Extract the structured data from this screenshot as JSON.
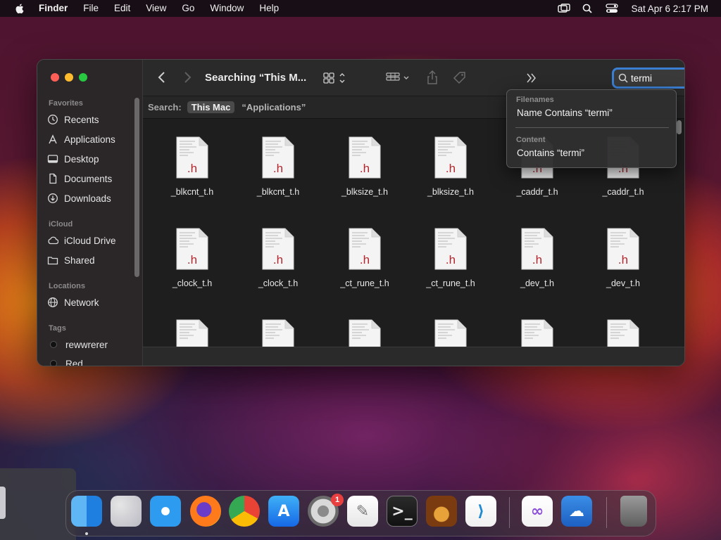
{
  "menubar": {
    "app_name": "Finder",
    "menus": [
      "File",
      "Edit",
      "View",
      "Go",
      "Window",
      "Help"
    ],
    "clock": "Sat Apr 6  2:17 PM"
  },
  "window": {
    "title": "Searching “This M...",
    "search_query": "termi"
  },
  "sidebar": {
    "favorites_header": "Favorites",
    "favorites": [
      "Recents",
      "Applications",
      "Desktop",
      "Documents",
      "Downloads"
    ],
    "icloud_header": "iCloud",
    "icloud": [
      "iCloud Drive",
      "Shared"
    ],
    "locations_header": "Locations",
    "locations": [
      "Network"
    ],
    "tags_header": "Tags",
    "tags": [
      "rewwrerer",
      "Red"
    ]
  },
  "scopebar": {
    "label": "Search:",
    "this_mac": "This Mac",
    "applications": "“Applications”"
  },
  "search_menu": {
    "filenames_header": "Filenames",
    "filenames_item": "Name Contains “termi”",
    "content_header": "Content",
    "content_item": "Contains “termi”"
  },
  "files": {
    "extension_badge": ".h",
    "row1": [
      "_blkcnt_t.h",
      "_blkcnt_t.h",
      "_blksize_t.h",
      "_blksize_t.h",
      "_caddr_t.h",
      "_caddr_t.h"
    ],
    "row2": [
      "_clock_t.h",
      "_clock_t.h",
      "_ct_rune_t.h",
      "_ct_rune_t.h",
      "_dev_t.h",
      "_dev_t.h"
    ]
  },
  "dock": {
    "apps": [
      "finder-icon",
      "launchpad-icon",
      "safari-icon",
      "firefox-icon",
      "chrome-icon",
      "app-store-icon",
      "system-settings-icon",
      "textedit-icon",
      "terminal-icon",
      "garageband-icon",
      "vscode-icon",
      "visual-studio-icon",
      "weather-icon",
      "trash-icon"
    ],
    "settings_badge": "1"
  },
  "colors": {
    "accent": "#3b7fd4",
    "file_ext": "#b3262d",
    "close": "#ff5f57",
    "minimize": "#febc2e",
    "zoom": "#28c840"
  }
}
